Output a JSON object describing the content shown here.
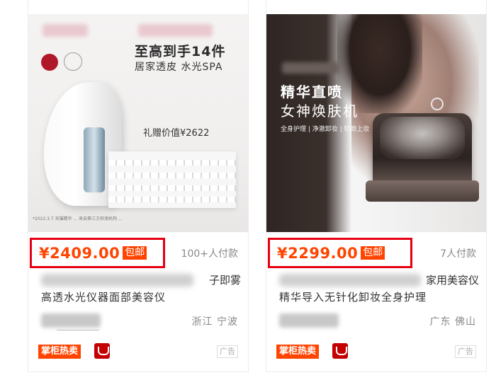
{
  "currency_symbol": "¥",
  "cards": [
    {
      "image": {
        "headline": "至高到手14件",
        "subline": "居家透皮 水光SPA",
        "gift": "礼赠价值¥2622",
        "fine_print": "*2022.3.7 天猫精华 ... 来自第三方检测机构 ..."
      },
      "price": "¥2409.00",
      "shipping_tag": "包邮",
      "paid_count": "100+人付款",
      "title_line1_tail": "子即雾",
      "title_line2": "高透水光仪器面部美容仪",
      "location": "浙江 宁波",
      "hot_tag": "掌柜热卖",
      "ad_label": "广告"
    },
    {
      "image": {
        "headline": "精华直喷",
        "subline": "女神焕肤机",
        "features": "全身护理 | 净澈卸妆 | 精致上妆"
      },
      "price": "¥2299.00",
      "shipping_tag": "包邮",
      "paid_count": "7人付款",
      "title_line1_tail": "家用美容仪",
      "title_line2": "精华导入无针化卸妆全身护理",
      "location": "广东 佛山",
      "hot_tag": "掌柜热卖",
      "ad_label": "广告"
    }
  ],
  "colors": {
    "price": "#ff4400",
    "highlight_border": "#e60012",
    "tag_bg": "#ff4400"
  },
  "icons": [
    "tmall-cat-icon"
  ]
}
